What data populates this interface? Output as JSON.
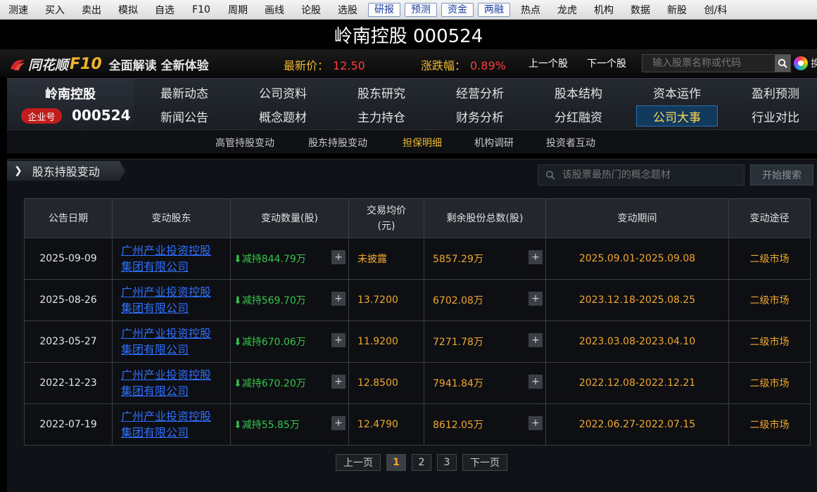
{
  "toolbar": [
    "测速",
    "买入",
    "卖出",
    "模拟",
    "自选",
    "F10",
    "周期",
    "画线",
    "论股",
    "选股",
    "研报",
    "预测",
    "资金",
    "两融",
    "热点",
    "龙虎",
    "机构",
    "数据",
    "新股",
    "创/科"
  ],
  "toolbar_boxed": [
    10,
    11,
    12,
    13
  ],
  "title": "岭南控股 000524",
  "f10": {
    "brand": "同花顺",
    "f10": "F10",
    "slogan": "全面解读 全新体验",
    "price_label": "最新价：",
    "price_value": "12.50",
    "change_label": "涨跌幅：",
    "change_value": "0.89%",
    "prev_stock": "上一个股",
    "next_stock": "下一个股",
    "search_placeholder": "输入股票名称或代码",
    "trailing": "换"
  },
  "company": {
    "name": "岭南控股",
    "badge": "企业号",
    "code": "000524"
  },
  "nav": {
    "row1": [
      "最新动态",
      "公司资料",
      "股东研究",
      "经营分析",
      "股本结构",
      "资本运作",
      "盈利预测"
    ],
    "row2": [
      "新闻公告",
      "概念题材",
      "主力持仓",
      "财务分析",
      "分红融资",
      "公司大事",
      "行业对比"
    ],
    "active": "公司大事"
  },
  "subnav": {
    "items": [
      "高管持股变动",
      "股东持股变动",
      "担保明细",
      "机构调研",
      "投资者互动"
    ],
    "active": "担保明细"
  },
  "section": {
    "title": "股东持股变动",
    "concept_placeholder": "该股票最热门的概念题材",
    "search_button": "开始搜索"
  },
  "table": {
    "headers": [
      "公告日期",
      "变动股东",
      "变动数量(股)",
      "交易均价\n(元)",
      "剩余股份总数(股)",
      "变动期间",
      "变动途径"
    ],
    "rows": [
      {
        "date": "2025-09-09",
        "holder": "广州产业投资控股\n集团有限公司",
        "qty": "减持844.79万",
        "price": "未披露",
        "remain": "5857.29万",
        "period": "2025.09.01-2025.09.08",
        "way": "二级市场"
      },
      {
        "date": "2025-08-26",
        "holder": "广州产业投资控股\n集团有限公司",
        "qty": "减持569.70万",
        "price": "13.7200",
        "remain": "6702.08万",
        "period": "2023.12.18-2025.08.25",
        "way": "二级市场"
      },
      {
        "date": "2023-05-27",
        "holder": "广州产业投资控股\n集团有限公司",
        "qty": "减持670.06万",
        "price": "11.9200",
        "remain": "7271.78万",
        "period": "2023.03.08-2023.04.10",
        "way": "二级市场"
      },
      {
        "date": "2022-12-23",
        "holder": "广州产业投资控股\n集团有限公司",
        "qty": "减持670.20万",
        "price": "12.8500",
        "remain": "7941.84万",
        "period": "2022.12.08-2022.12.21",
        "way": "二级市场"
      },
      {
        "date": "2022-07-19",
        "holder": "广州产业投资控股\n集团有限公司",
        "qty": "减持55.85万",
        "price": "12.4790",
        "remain": "8612.05万",
        "period": "2022.06.27-2022.07.15",
        "way": "二级市场"
      }
    ]
  },
  "pager": {
    "prev": "上一页",
    "pages": [
      "1",
      "2",
      "3"
    ],
    "current": "1",
    "next": "下一页"
  },
  "colors": {
    "accent_gold": "#f0b830",
    "up_red": "#ff3d3d",
    "down_green": "#35c54a",
    "link_blue": "#2f6fff"
  }
}
